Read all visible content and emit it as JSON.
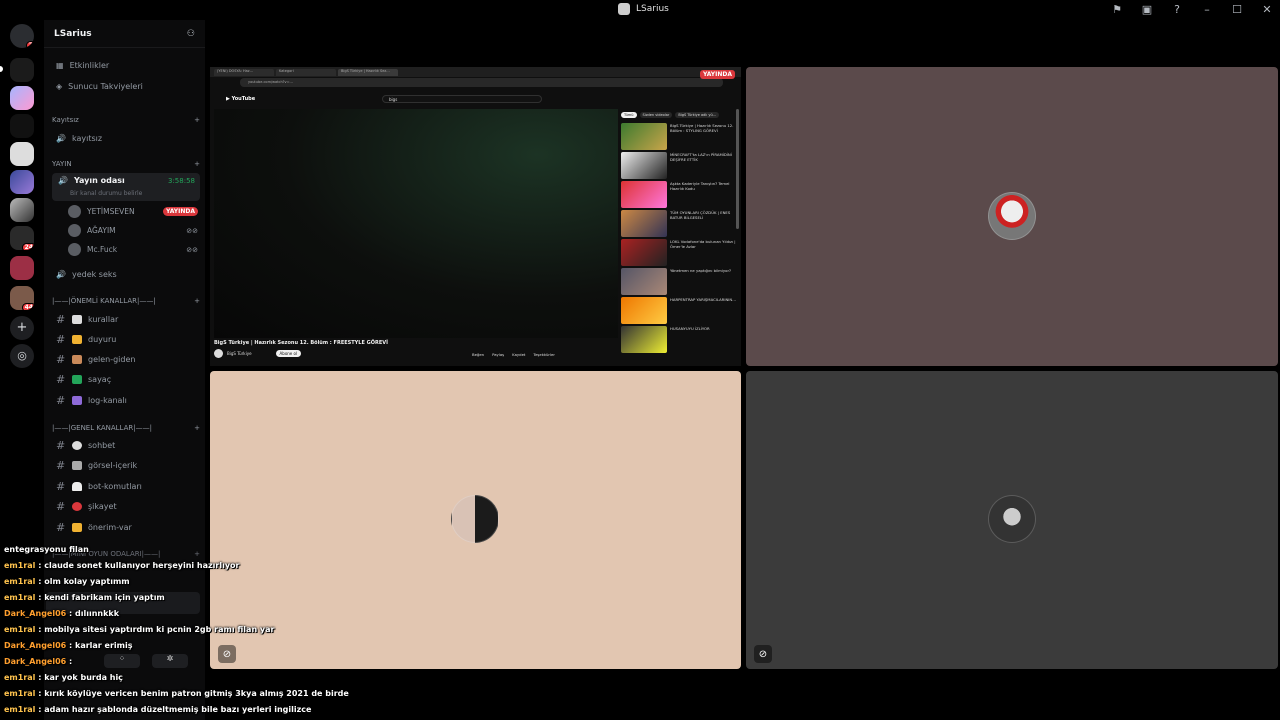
{
  "window": {
    "title": "LSarius"
  },
  "guilds": {
    "badges": [
      "7",
      "24",
      "44"
    ]
  },
  "server": {
    "name": "LSarius"
  },
  "sidebar": {
    "events": "Etkinlikler",
    "boosts": "Sunucu Takviyeleri",
    "cat_kayitsiz": "Kayıtsız",
    "ch_kayitsiz": "kayıtsız",
    "cat_yayin": "YAYIN",
    "voice_channel": "Yayın odası",
    "voice_timer": "3:58:58",
    "voice_status": "Bir kanal durumu belirle",
    "users": [
      {
        "name": "YETİMSEVEN",
        "live": "YAYINDA"
      },
      {
        "name": "AĞAYIM"
      },
      {
        "name": "Mc.Fuck"
      }
    ],
    "yedek": "yedek seks",
    "cat_onemli": "|——|ÖNEMLİ KANALLAR|——|",
    "onemli": [
      "kurallar",
      "duyuru",
      "gelen-giden",
      "sayaç",
      "log-kanalı"
    ],
    "cat_genel": "|——|GENEL KANALLAR|——|",
    "genel": [
      "sohbet",
      "görsel-içerik",
      "bot-komutları",
      "şikayet",
      "önerim-var"
    ],
    "cat_oyun": "|——|MİNİ OYUN ODALARI|——|"
  },
  "browser": {
    "tabs": [
      "(YENİ) DOSYA: Haz…",
      "Kategori",
      "BigS Türkiye | Hazırlık Sez…"
    ],
    "url": "youtube.com/watch?v=…",
    "search": "bigs",
    "chips": [
      "Tümü",
      "Sizden videolar",
      "BigS Türkiye adlı yü…"
    ],
    "video_title": "BigS Türkiye | Hazırlık Sezonu 12. Bölüm : FREESTYLE GÖREVİ",
    "channel": "BigS Türkiye",
    "subscribe": "Abone ol",
    "live_badge": "YAYINDA",
    "recs": [
      "BigS Türkiye | Hazırlık Sezonu 12. Bölüm : STYLING GÖREVİ",
      "MİNECRAFT'ta LAZ'ın PİRAMİDİNİ DEŞİFRE ETTİK",
      "Aşkta Kaderiyle Tanıştın? Temel Hazırlık Kodu",
      "TÜM OYUNLARI ÇÖZDÜK | ENES BATUR BİLGESELİ",
      "LOKL Vodafone'da bulunan Yıldızı | Ömer'le Avlar",
      "Yönetmen ne yaptığını bilmiyor?",
      "HARPENTRAP YARIŞMACILARININ…",
      "HUSANYUYU İZLİYOR"
    ],
    "actions": [
      "Beğen",
      "Paylaş",
      "Kaydet",
      "Teşekkürler"
    ]
  },
  "chat": [
    {
      "nick": "",
      "text": "entegrasyonu filan",
      "style": "plain"
    },
    {
      "nick": "em1ral",
      "text": "claude sonet kullanıyor herşeyini hazırlıyor"
    },
    {
      "nick": "em1ral",
      "text": "olm kolay yaptımm"
    },
    {
      "nick": "em1ral",
      "text": "kendi fabrikam için yaptım"
    },
    {
      "nick": "Dark_Angel06",
      "text": "dılıınnkkk"
    },
    {
      "nick": "em1ral",
      "text": "mobilya sitesi yaptırdım ki pcnin 2gb ramı filan yar"
    },
    {
      "nick": "Dark_Angel06",
      "text": "karlar erimiş"
    },
    {
      "nick": "Dark_Angel06",
      "text": ""
    },
    {
      "nick": "em1ral",
      "text": "kar yok burda hiç"
    },
    {
      "nick": "em1ral",
      "text": "kırık köylüye vericen benim patron gitmiş 3kya almış 2021 de birde"
    },
    {
      "nick": "em1ral",
      "text": "adam hazır şablonda düzeltmemiş bile bazı yerleri ingilizce"
    }
  ],
  "colors": {
    "tile_tr": "#5b4a4b",
    "tile_bl": "#e2c6b1",
    "tile_br": "#3b3b3b",
    "live": "#da373c",
    "voice_green": "#23a55a"
  }
}
